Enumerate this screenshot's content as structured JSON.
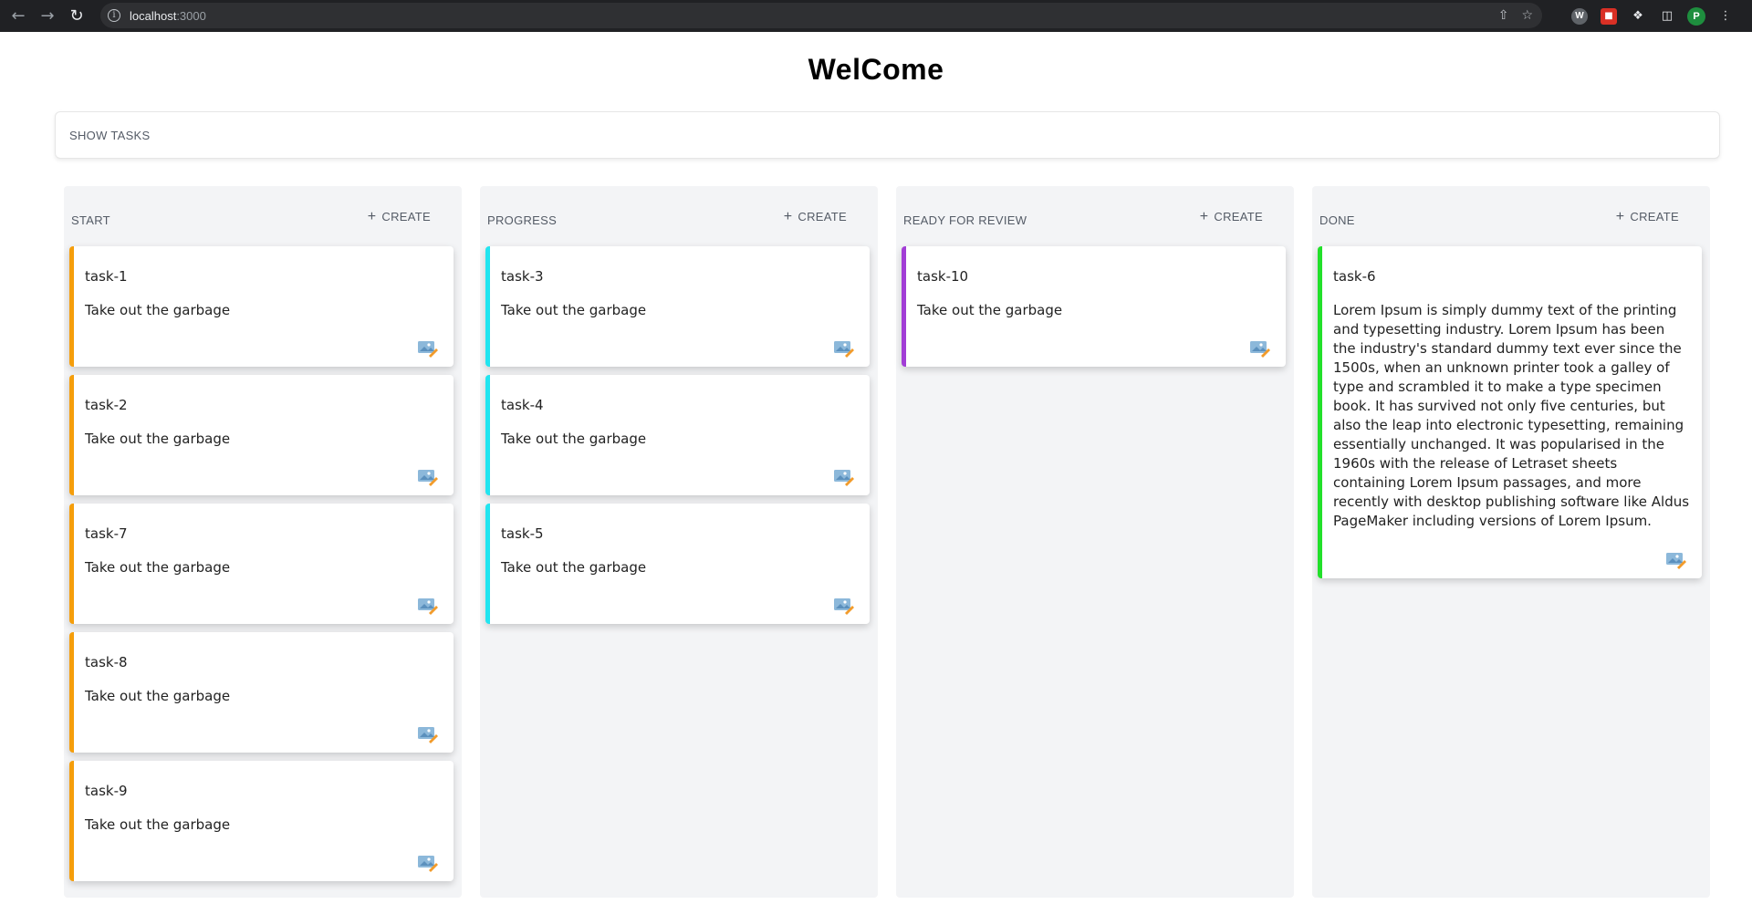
{
  "browser": {
    "url_host": "localhost",
    "url_port": ":3000",
    "profile_initial": "P"
  },
  "page": {
    "title": "WelCome",
    "show_tasks_label": "SHOW TASKS"
  },
  "columns": [
    {
      "title": "START",
      "create_label": "CREATE",
      "accent": "#f59e0b",
      "cards": [
        {
          "title": "task-1",
          "desc": "Take out the garbage"
        },
        {
          "title": "task-2",
          "desc": "Take out the garbage"
        },
        {
          "title": "task-7",
          "desc": "Take out the garbage"
        },
        {
          "title": "task-8",
          "desc": "Take out the garbage"
        },
        {
          "title": "task-9",
          "desc": "Take out the garbage"
        }
      ]
    },
    {
      "title": "PROGRESS",
      "create_label": "CREATE",
      "accent": "#22e5f0",
      "cards": [
        {
          "title": "task-3",
          "desc": "Take out the garbage"
        },
        {
          "title": "task-4",
          "desc": "Take out the garbage"
        },
        {
          "title": "task-5",
          "desc": "Take out the garbage"
        }
      ]
    },
    {
      "title": "READY FOR REVIEW",
      "create_label": "CREATE",
      "accent": "#a23dd6",
      "cards": [
        {
          "title": "task-10",
          "desc": "Take out the garbage"
        }
      ]
    },
    {
      "title": "DONE",
      "create_label": "CREATE",
      "accent": "#22e02a",
      "cards": [
        {
          "title": "task-6",
          "desc": "Lorem Ipsum is simply dummy text of the printing and typesetting industry. Lorem Ipsum has been the industry's standard dummy text ever since the 1500s, when an unknown printer took a galley of type and scrambled it to make a type specimen book. It has survived not only five centuries, but also the leap into electronic typesetting, remaining essentially unchanged. It was popularised in the 1960s with the release of Letraset sheets containing Lorem Ipsum passages, and more recently with desktop publishing software like Aldus PageMaker including versions of Lorem Ipsum."
        }
      ]
    }
  ]
}
